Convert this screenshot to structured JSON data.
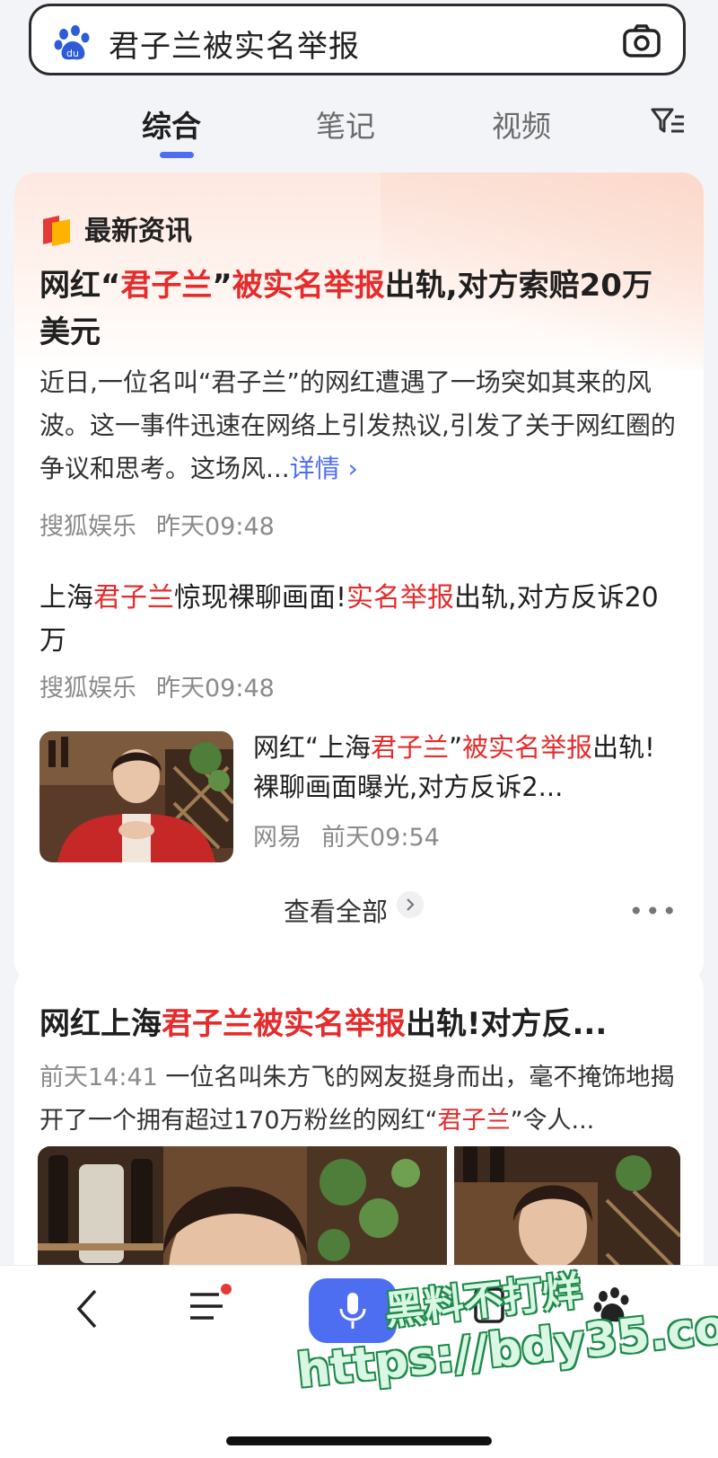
{
  "search": {
    "query": "君子兰被实名举报"
  },
  "tabs": [
    "综合",
    "笔记",
    "视频"
  ],
  "news_section": {
    "heading": "最新资讯"
  },
  "top_story": {
    "title_parts": [
      "网红“",
      "君子兰",
      "”",
      "被实名举报",
      "出轨,对方索赔20万美元"
    ],
    "summary": "近日,一位名叫“君子兰”的网红遭遇了一场突如其来的风波。这一事件迅速在网络上引发热议,引发了关于网红圈的争议和思考。这场风...",
    "detail_link": "详情 ›",
    "source": "搜狐娱乐",
    "time": "昨天09:48"
  },
  "story2": {
    "title_parts": [
      "上海",
      "君子兰",
      "惊现裸聊画面!",
      "实名举报",
      "出轨,对方反诉20万"
    ],
    "source": "搜狐娱乐",
    "time": "昨天09:48"
  },
  "story3": {
    "title_parts": [
      "网红“上海",
      "君子兰",
      "”",
      "被实名举报",
      "出轨!裸聊画面曝光,对方反诉2..."
    ],
    "source": "网易",
    "time": "前天09:54"
  },
  "view_all": "查看全部",
  "more": "•••",
  "result2": {
    "title_parts": [
      "网红上海",
      "君子兰被实名举报",
      "出轨!对方反..."
    ],
    "time": "前天14:41",
    "snippet_parts": [
      "一位名叫朱方飞的网友挺身而出，毫不掩饰地揭开了一个拥有超过170万粉丝的网红“",
      "君子兰",
      "”令人..."
    ]
  },
  "watermark": {
    "line1": "黑料不打烊",
    "line2": "https://bdy35.co"
  },
  "colors": {
    "accent": "#4e6ef2",
    "highlight": "#e52b2b",
    "badge_dot": "#e53935"
  }
}
